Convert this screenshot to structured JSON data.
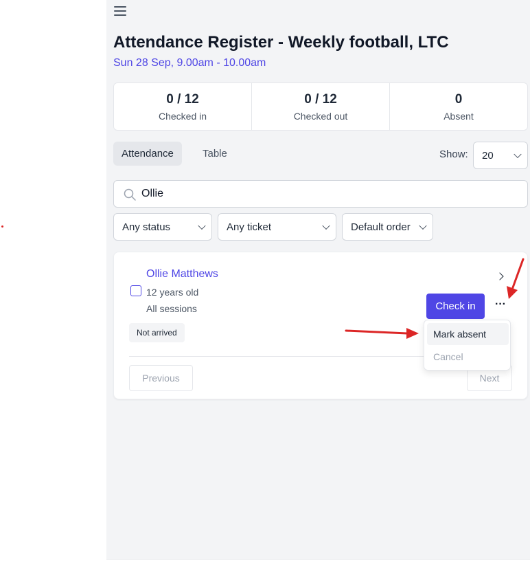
{
  "header": {
    "title": "Attendance Register - Weekly football, LTC",
    "subtitle": "Sun 28 Sep, 9.00am - 10.00am"
  },
  "stats": [
    {
      "value": "0 / 12",
      "label": "Checked in"
    },
    {
      "value": "0 / 12",
      "label": "Checked out"
    },
    {
      "value": "0",
      "label": "Absent"
    }
  ],
  "tabs": {
    "attendance": "Attendance",
    "table": "Table"
  },
  "show": {
    "label": "Show:",
    "value": "20"
  },
  "search": {
    "value": "Ollie",
    "icon": "search-icon"
  },
  "filters": {
    "status": "Any status",
    "ticket": "Any ticket",
    "order": "Default order"
  },
  "attendee": {
    "name": "Ollie Matthews",
    "age": "12 years old",
    "sessions": "All sessions",
    "status": "Not arrived",
    "checkin_label": "Check in",
    "more_label": "···"
  },
  "pagination": {
    "previous": "Previous",
    "next": "Next"
  },
  "menu": {
    "mark_absent": "Mark absent",
    "cancel": "Cancel"
  },
  "colors": {
    "accent": "#4f46e5",
    "annotation": "#dc2626"
  }
}
